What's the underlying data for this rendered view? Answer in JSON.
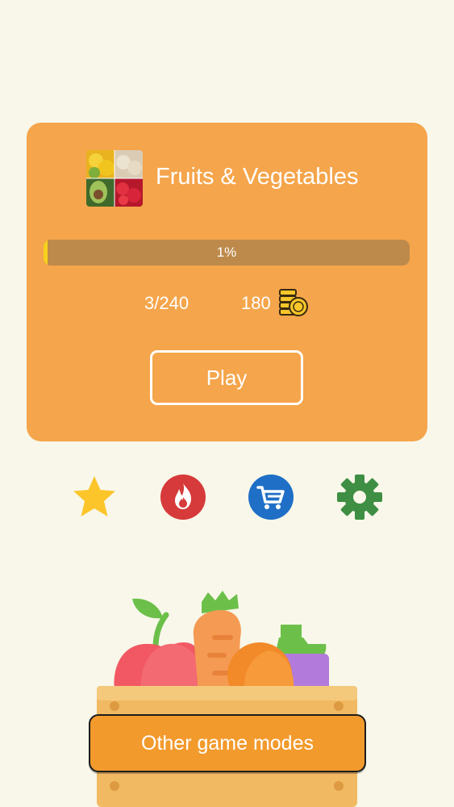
{
  "category": {
    "title": "Fruits & Vegetables",
    "progress_percent": 1,
    "progress_label": "1%",
    "levels_label": "3/240",
    "coins": "180",
    "play_label": "Play"
  },
  "toolbar": {
    "favorites_icon": "star-icon",
    "hot_icon": "fire-icon",
    "shop_icon": "cart-icon",
    "settings_icon": "gear-icon"
  },
  "other_modes_label": "Other game modes",
  "colors": {
    "background": "#f8f7e9",
    "card": "#f5a54b",
    "progress_track": "#bd8a4b",
    "progress_fill": "#f7d11c",
    "star": "#fcc52a",
    "fire": "#d63a3a",
    "cart": "#1f6fc7",
    "gear": "#3e8f43",
    "button": "#f39a2c"
  }
}
